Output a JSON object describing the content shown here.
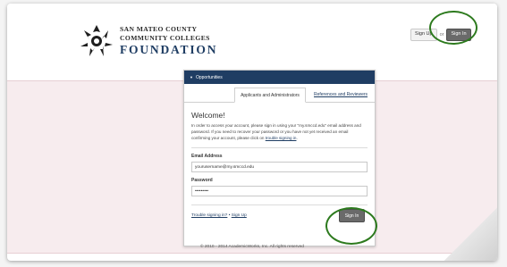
{
  "header": {
    "logo_line1": "SAN MATEO COUNTY",
    "logo_line2": "COMMUNITY COLLEGES",
    "logo_line3": "FOUNDATION",
    "signup_label": "Sign Up",
    "or_label": "or",
    "signin_label": "Sign In"
  },
  "card": {
    "title": "Opportunities",
    "tabs": [
      "Applicants and Administrators",
      "References and Reviewers"
    ],
    "welcome": "Welcome!",
    "intro_text": "In order to access your account, please sign in using your \"my.smccd.edu\" email address and password. If you need to recover your password or you have not yet received an email confirming your account, please click on ",
    "intro_link": "trouble signing in",
    "intro_end": ".",
    "email_label": "Email Address",
    "email_value": "yourusername@my.smccd.edu",
    "password_label": "Password",
    "password_value": "•••••••••",
    "trouble_link": "Trouble signing in?",
    "separator": " • ",
    "signup_link": "Sign Up",
    "signin_button": "Sign In"
  },
  "footer": {
    "copyright": "© 2010 - 2014 AcademicWorks, Inc. All rights reserved"
  },
  "colors": {
    "brand_navy": "#1f3d63",
    "highlight_ring": "#2d7a1e",
    "band_pink": "#f7ecee"
  },
  "icons": {
    "logo": "foundation-logo-icon",
    "caret": "caret-down-icon"
  }
}
